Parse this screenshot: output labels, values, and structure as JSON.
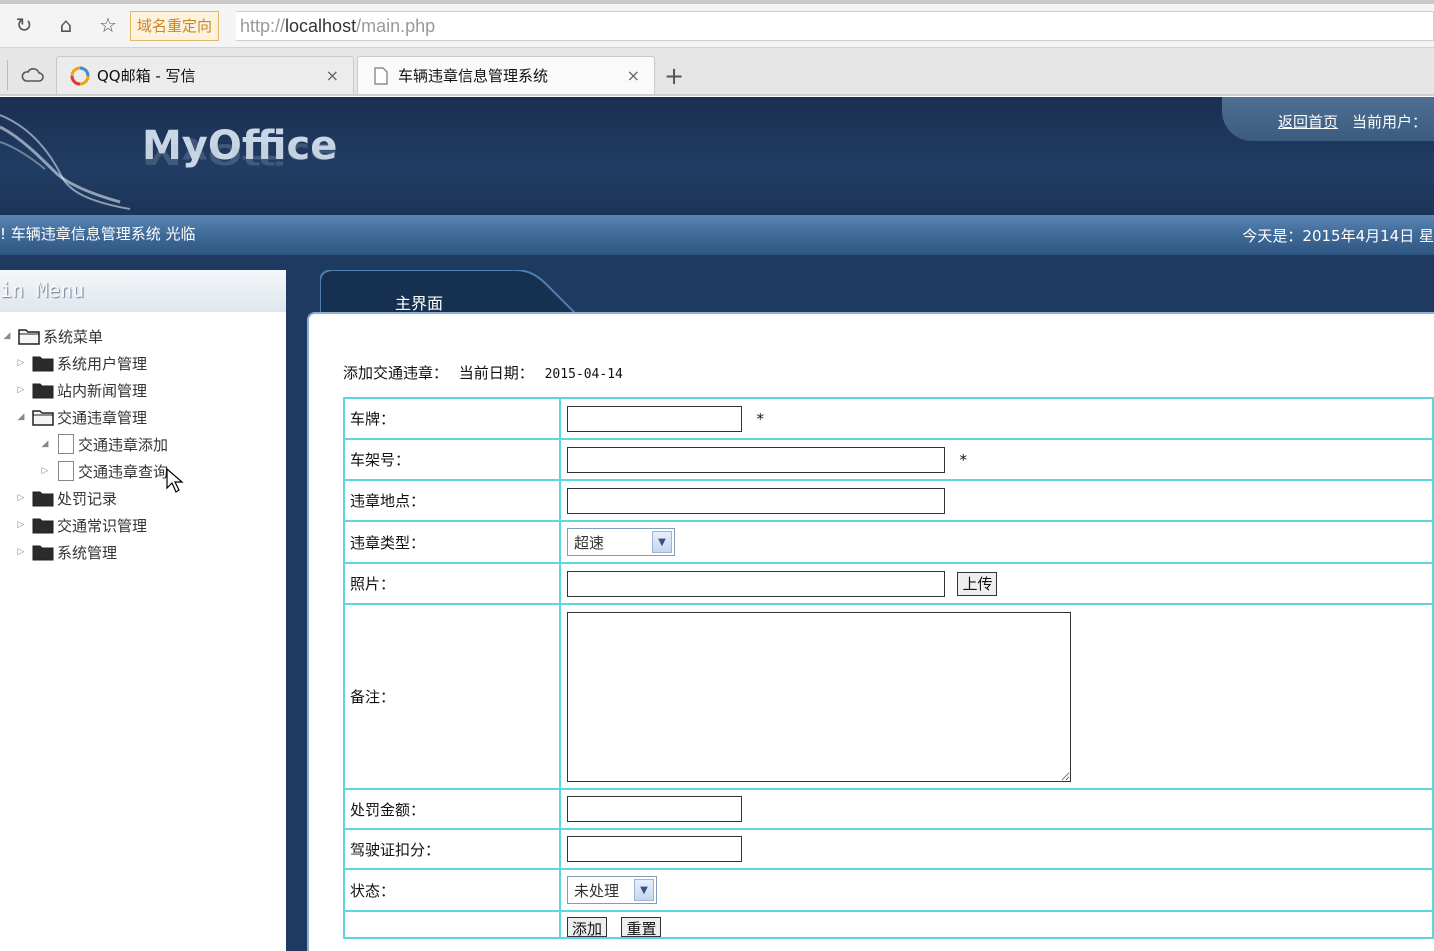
{
  "browser": {
    "redirect_badge": "域名重定向",
    "url_scheme": "http://",
    "url_host": "localhost",
    "url_path": "/main.php",
    "tabs": [
      {
        "label": "QQ邮箱 - 写信",
        "close": "×"
      },
      {
        "label": "车辆违章信息管理系统",
        "close": "×"
      }
    ],
    "new_tab": "+"
  },
  "header": {
    "logo": "MyOffice",
    "home_link": "返回首页",
    "current_user": "当前用户："
  },
  "welcome": {
    "left": "! 车辆违章信息管理系统 光临",
    "right": "今天是：2015年4月14日 星"
  },
  "sidebar": {
    "title": "in Menu",
    "root": "系统菜单",
    "items": [
      {
        "label": "系统用户管理"
      },
      {
        "label": "站内新闻管理"
      },
      {
        "label": "交通违章管理"
      },
      {
        "label": "交通违章添加"
      },
      {
        "label": "交通违章查询"
      },
      {
        "label": "处罚记录"
      },
      {
        "label": "交通常识管理"
      },
      {
        "label": "系统管理"
      }
    ]
  },
  "main": {
    "tab_label": "主界面",
    "heading_title": "添加交通违章：",
    "heading_date_label": "当前日期：",
    "heading_date": "2015-04-14",
    "form": {
      "plate_label": "车牌：",
      "frame_label": "车架号：",
      "location_label": "违章地点：",
      "type_label": "违章类型：",
      "type_value": "超速",
      "photo_label": "照片：",
      "upload_button": "上传",
      "remark_label": "备注：",
      "fine_label": "处罚金额：",
      "points_label": "驾驶证扣分：",
      "status_label": "状态：",
      "status_value": "未处理",
      "required_mark": "*",
      "add_button": "添加",
      "reset_button": "重置"
    }
  }
}
